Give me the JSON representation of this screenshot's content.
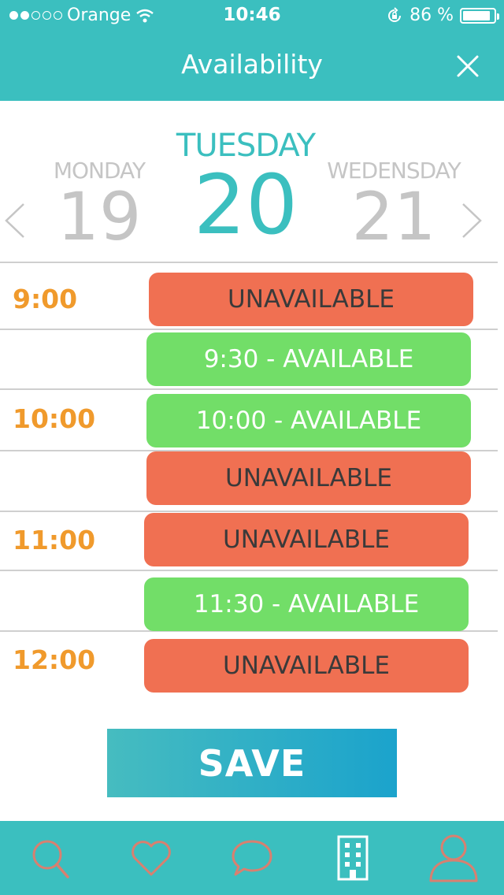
{
  "status_bar": {
    "carrier": "Orange",
    "time": "10:46",
    "battery_percent": "86 %",
    "signal_bars_filled": 2,
    "signal_bars_total": 5
  },
  "header": {
    "title": "Availability",
    "close_icon": "close-icon"
  },
  "day_picker": {
    "previous": {
      "name": "MONDAY",
      "number": "19"
    },
    "current": {
      "name": "TUESDAY",
      "number": "20"
    },
    "next": {
      "name": "WEDENSDAY",
      "number": "21"
    }
  },
  "schedule": {
    "hours": [
      "9:00",
      "10:00",
      "11:00",
      "12:00"
    ],
    "slots": [
      {
        "label": "UNAVAILABLE",
        "status": "unavailable"
      },
      {
        "label": "9:30 - AVAILABLE",
        "status": "available"
      },
      {
        "label": "10:00 - AVAILABLE",
        "status": "available"
      },
      {
        "label": "UNAVAILABLE",
        "status": "unavailable"
      },
      {
        "label": "UNAVAILABLE",
        "status": "unavailable"
      },
      {
        "label": "11:30 - AVAILABLE",
        "status": "available"
      },
      {
        "label": "UNAVAILABLE",
        "status": "unavailable"
      }
    ]
  },
  "save_label": "SAVE",
  "tab_bar": {
    "tabs": [
      "search-icon",
      "heart-icon",
      "chat-icon",
      "building-icon",
      "profile-icon"
    ],
    "active_tab": "building-icon"
  },
  "colors": {
    "brand": "#3bbfbf",
    "hour_label": "#f09a2c",
    "unavailable": "#f07052",
    "available": "#72de68"
  }
}
